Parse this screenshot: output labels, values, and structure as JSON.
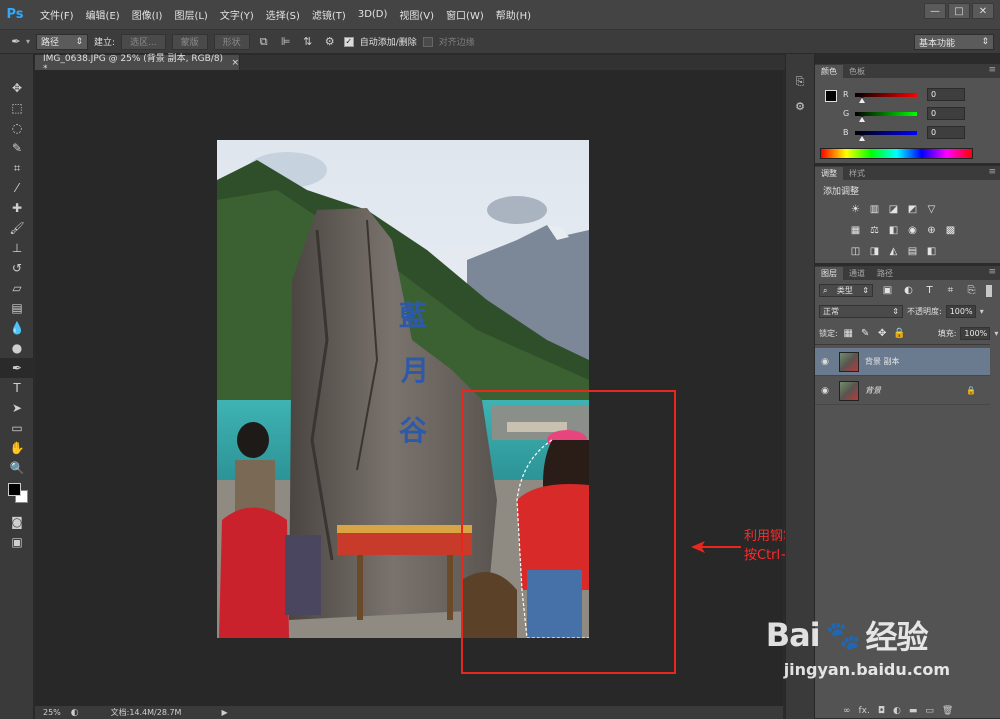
{
  "app": {
    "logo": "Ps"
  },
  "menu": [
    "文件(F)",
    "编辑(E)",
    "图像(I)",
    "图层(L)",
    "文字(Y)",
    "选择(S)",
    "滤镜(T)",
    "3D(D)",
    "视图(V)",
    "窗口(W)",
    "帮助(H)"
  ],
  "window_controls": [
    "—",
    "□",
    "✕"
  ],
  "options": {
    "mode": "路径",
    "create_label": "建立:",
    "selection_btn": "选区...",
    "mask_btn": "蒙版",
    "shape_btn": "形状",
    "auto_add_delete": "自动添加/删除",
    "align_edges": "对齐边缘",
    "workspace": "基本功能"
  },
  "document": {
    "tab_title": "IMG_0638.JPG @ 25% (背景 副本, RGB/8) *",
    "close": "×",
    "zoom": "25%",
    "doc_info": "文档:14.4M/28.7M"
  },
  "annotation": {
    "text": "利用钢笔工具将人物的轮廓描绘出来然后按Ctrl+回车键，将路径变为选取",
    "color": "#ff2a2a"
  },
  "color_panel": {
    "tabs": [
      "颜色",
      "色板"
    ],
    "channels": [
      {
        "label": "R",
        "value": "0"
      },
      {
        "label": "G",
        "value": "0"
      },
      {
        "label": "B",
        "value": "0"
      }
    ]
  },
  "adjust_panel": {
    "tabs": [
      "调整",
      "样式"
    ],
    "title": "添加调整"
  },
  "layers_panel": {
    "tabs": [
      "图层",
      "通道",
      "路径"
    ],
    "filter": "类型",
    "blend_mode": "正常",
    "opacity_label": "不透明度:",
    "opacity": "100%",
    "lock_label": "锁定:",
    "fill_label": "填充:",
    "fill": "100%",
    "layers": [
      {
        "name": "背景 副本",
        "selected": true
      },
      {
        "name": "背景",
        "selected": false,
        "locked": true
      }
    ]
  },
  "watermark": {
    "brand": "Bai",
    "brand2": "经验",
    "url": "jingyan.baidu.com"
  }
}
